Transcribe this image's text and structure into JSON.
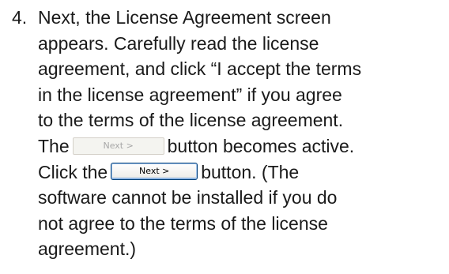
{
  "step": {
    "number": "4.",
    "line1": "Next, the License Agreement screen",
    "line2": "appears. Carefully read the license",
    "line3": "agreement, and click “I accept the terms",
    "line4": "in the license agreement” if you agree",
    "line5": "to the terms of the license agreement.",
    "line6_before": "The",
    "line6_after": "button becomes active.",
    "line7_before": "Click the",
    "line7_after": "button. (The",
    "line8": "software cannot be installed if you do",
    "line9": "not agree to the terms of the license",
    "line10": "agreement.)"
  },
  "buttons": {
    "next_disabled_label": "Next >",
    "next_active_label": "Next >"
  }
}
